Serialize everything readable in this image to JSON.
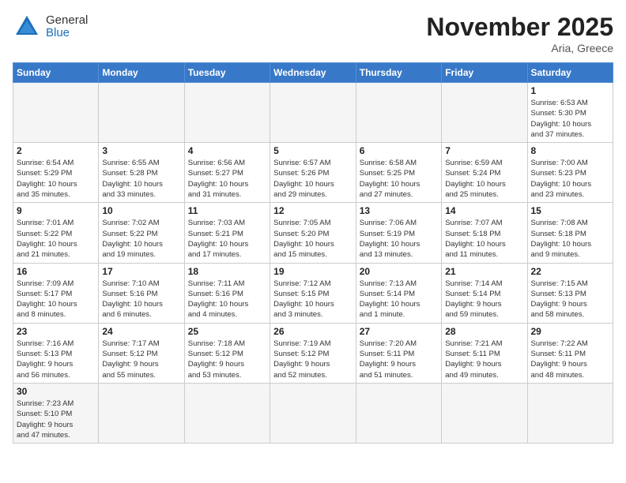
{
  "header": {
    "logo_general": "General",
    "logo_blue": "Blue",
    "month_title": "November 2025",
    "subtitle": "Aria, Greece"
  },
  "weekdays": [
    "Sunday",
    "Monday",
    "Tuesday",
    "Wednesday",
    "Thursday",
    "Friday",
    "Saturday"
  ],
  "weeks": [
    [
      {
        "day": "",
        "info": ""
      },
      {
        "day": "",
        "info": ""
      },
      {
        "day": "",
        "info": ""
      },
      {
        "day": "",
        "info": ""
      },
      {
        "day": "",
        "info": ""
      },
      {
        "day": "",
        "info": ""
      },
      {
        "day": "1",
        "info": "Sunrise: 6:53 AM\nSunset: 5:30 PM\nDaylight: 10 hours\nand 37 minutes."
      }
    ],
    [
      {
        "day": "2",
        "info": "Sunrise: 6:54 AM\nSunset: 5:29 PM\nDaylight: 10 hours\nand 35 minutes."
      },
      {
        "day": "3",
        "info": "Sunrise: 6:55 AM\nSunset: 5:28 PM\nDaylight: 10 hours\nand 33 minutes."
      },
      {
        "day": "4",
        "info": "Sunrise: 6:56 AM\nSunset: 5:27 PM\nDaylight: 10 hours\nand 31 minutes."
      },
      {
        "day": "5",
        "info": "Sunrise: 6:57 AM\nSunset: 5:26 PM\nDaylight: 10 hours\nand 29 minutes."
      },
      {
        "day": "6",
        "info": "Sunrise: 6:58 AM\nSunset: 5:25 PM\nDaylight: 10 hours\nand 27 minutes."
      },
      {
        "day": "7",
        "info": "Sunrise: 6:59 AM\nSunset: 5:24 PM\nDaylight: 10 hours\nand 25 minutes."
      },
      {
        "day": "8",
        "info": "Sunrise: 7:00 AM\nSunset: 5:23 PM\nDaylight: 10 hours\nand 23 minutes."
      }
    ],
    [
      {
        "day": "9",
        "info": "Sunrise: 7:01 AM\nSunset: 5:22 PM\nDaylight: 10 hours\nand 21 minutes."
      },
      {
        "day": "10",
        "info": "Sunrise: 7:02 AM\nSunset: 5:22 PM\nDaylight: 10 hours\nand 19 minutes."
      },
      {
        "day": "11",
        "info": "Sunrise: 7:03 AM\nSunset: 5:21 PM\nDaylight: 10 hours\nand 17 minutes."
      },
      {
        "day": "12",
        "info": "Sunrise: 7:05 AM\nSunset: 5:20 PM\nDaylight: 10 hours\nand 15 minutes."
      },
      {
        "day": "13",
        "info": "Sunrise: 7:06 AM\nSunset: 5:19 PM\nDaylight: 10 hours\nand 13 minutes."
      },
      {
        "day": "14",
        "info": "Sunrise: 7:07 AM\nSunset: 5:18 PM\nDaylight: 10 hours\nand 11 minutes."
      },
      {
        "day": "15",
        "info": "Sunrise: 7:08 AM\nSunset: 5:18 PM\nDaylight: 10 hours\nand 9 minutes."
      }
    ],
    [
      {
        "day": "16",
        "info": "Sunrise: 7:09 AM\nSunset: 5:17 PM\nDaylight: 10 hours\nand 8 minutes."
      },
      {
        "day": "17",
        "info": "Sunrise: 7:10 AM\nSunset: 5:16 PM\nDaylight: 10 hours\nand 6 minutes."
      },
      {
        "day": "18",
        "info": "Sunrise: 7:11 AM\nSunset: 5:16 PM\nDaylight: 10 hours\nand 4 minutes."
      },
      {
        "day": "19",
        "info": "Sunrise: 7:12 AM\nSunset: 5:15 PM\nDaylight: 10 hours\nand 3 minutes."
      },
      {
        "day": "20",
        "info": "Sunrise: 7:13 AM\nSunset: 5:14 PM\nDaylight: 10 hours\nand 1 minute."
      },
      {
        "day": "21",
        "info": "Sunrise: 7:14 AM\nSunset: 5:14 PM\nDaylight: 9 hours\nand 59 minutes."
      },
      {
        "day": "22",
        "info": "Sunrise: 7:15 AM\nSunset: 5:13 PM\nDaylight: 9 hours\nand 58 minutes."
      }
    ],
    [
      {
        "day": "23",
        "info": "Sunrise: 7:16 AM\nSunset: 5:13 PM\nDaylight: 9 hours\nand 56 minutes."
      },
      {
        "day": "24",
        "info": "Sunrise: 7:17 AM\nSunset: 5:12 PM\nDaylight: 9 hours\nand 55 minutes."
      },
      {
        "day": "25",
        "info": "Sunrise: 7:18 AM\nSunset: 5:12 PM\nDaylight: 9 hours\nand 53 minutes."
      },
      {
        "day": "26",
        "info": "Sunrise: 7:19 AM\nSunset: 5:12 PM\nDaylight: 9 hours\nand 52 minutes."
      },
      {
        "day": "27",
        "info": "Sunrise: 7:20 AM\nSunset: 5:11 PM\nDaylight: 9 hours\nand 51 minutes."
      },
      {
        "day": "28",
        "info": "Sunrise: 7:21 AM\nSunset: 5:11 PM\nDaylight: 9 hours\nand 49 minutes."
      },
      {
        "day": "29",
        "info": "Sunrise: 7:22 AM\nSunset: 5:11 PM\nDaylight: 9 hours\nand 48 minutes."
      }
    ],
    [
      {
        "day": "30",
        "info": "Sunrise: 7:23 AM\nSunset: 5:10 PM\nDaylight: 9 hours\nand 47 minutes."
      },
      {
        "day": "",
        "info": ""
      },
      {
        "day": "",
        "info": ""
      },
      {
        "day": "",
        "info": ""
      },
      {
        "day": "",
        "info": ""
      },
      {
        "day": "",
        "info": ""
      },
      {
        "day": "",
        "info": ""
      }
    ]
  ]
}
